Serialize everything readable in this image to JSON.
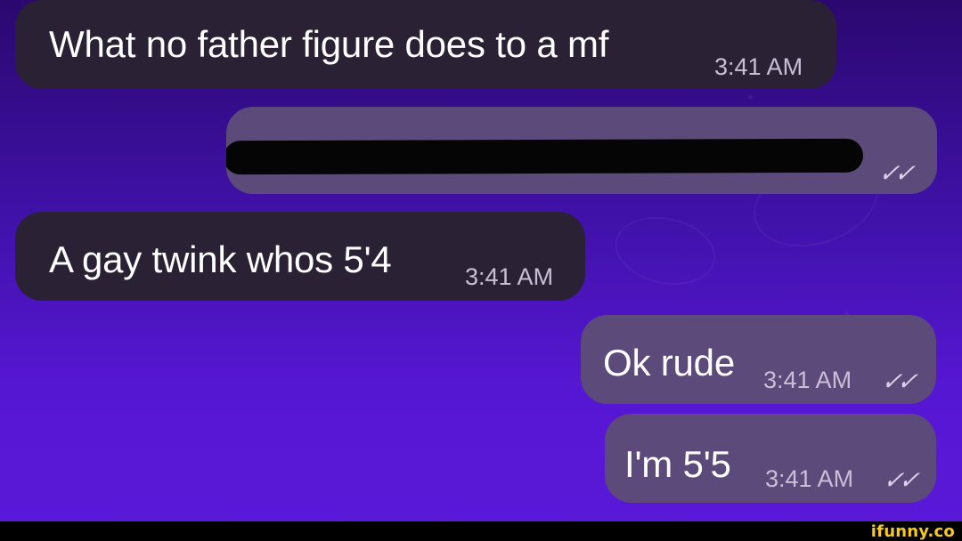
{
  "chat": {
    "messages": [
      {
        "text": "What no father figure does to a mf",
        "time": "3:41 AM"
      },
      {
        "text": "",
        "time": "",
        "status": "double-check-icon"
      },
      {
        "text": "A gay twink whos 5'4",
        "time": "3:41 AM"
      },
      {
        "text": "Ok rude",
        "time": "3:41 AM",
        "status": "double-check-icon"
      },
      {
        "text": "I'm 5'5",
        "time": "3:41 AM",
        "status": "double-check-icon"
      }
    ]
  },
  "ui": {
    "ticks": "✓✓",
    "watermark": "ifunny.co"
  },
  "colors": {
    "incoming_bubble": "#2a2234",
    "outgoing_bubble": "#5c4a7a",
    "background_top": "#2a086f",
    "background_bottom": "#5a18d8",
    "watermark": "#f5ca24"
  }
}
